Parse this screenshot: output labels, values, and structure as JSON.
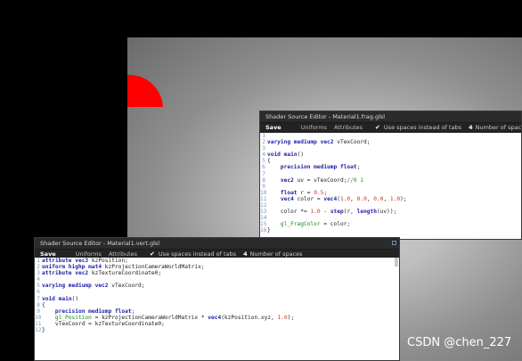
{
  "frag_editor": {
    "title": "Shader Source Editor - Material1.frag.glsl",
    "save_label": "Save",
    "tab_uniforms": "Uniforms",
    "tab_attributes": "Attributes",
    "checkbox_label": "Use spaces instead of tabs",
    "spaces_value": "4",
    "spaces_label": "Number of spaces",
    "lines": [
      {
        "n": "1",
        "segs": []
      },
      {
        "n": "2",
        "segs": [
          [
            "kw",
            "varying mediump vec2"
          ],
          [
            "txt",
            " vTexCoord;"
          ]
        ]
      },
      {
        "n": "3",
        "segs": []
      },
      {
        "n": "4",
        "segs": [
          [
            "kw",
            "void"
          ],
          [
            "txt",
            " "
          ],
          [
            "kw",
            "main"
          ],
          [
            "txt",
            "()"
          ]
        ]
      },
      {
        "n": "5",
        "segs": [
          [
            "txt",
            "{"
          ]
        ]
      },
      {
        "n": "6",
        "segs": [
          [
            "txt",
            "    "
          ],
          [
            "kw",
            "precision mediump float"
          ],
          [
            "txt",
            ";"
          ]
        ]
      },
      {
        "n": "7",
        "segs": []
      },
      {
        "n": "8",
        "segs": [
          [
            "txt",
            "    "
          ],
          [
            "kw",
            "vec2"
          ],
          [
            "txt",
            " uv = vTexCoord;"
          ],
          [
            "com",
            "//0 1"
          ]
        ]
      },
      {
        "n": "9",
        "segs": []
      },
      {
        "n": "10",
        "segs": [
          [
            "txt",
            "    "
          ],
          [
            "kw",
            "float"
          ],
          [
            "txt",
            " r = "
          ],
          [
            "num-lit",
            "0.5"
          ],
          [
            "txt",
            ";"
          ]
        ]
      },
      {
        "n": "11",
        "segs": [
          [
            "txt",
            "    "
          ],
          [
            "kw",
            "vec4"
          ],
          [
            "txt",
            " color = "
          ],
          [
            "kw",
            "vec4"
          ],
          [
            "txt",
            "("
          ],
          [
            "num-lit",
            "1.0"
          ],
          [
            "txt",
            ", "
          ],
          [
            "num-lit",
            "0.0"
          ],
          [
            "txt",
            ", "
          ],
          [
            "num-lit",
            "0.0"
          ],
          [
            "txt",
            ", "
          ],
          [
            "num-lit",
            "1.0"
          ],
          [
            "txt",
            ");"
          ]
        ]
      },
      {
        "n": "12",
        "segs": []
      },
      {
        "n": "13",
        "segs": [
          [
            "txt",
            "    color *= "
          ],
          [
            "num-lit",
            "1.0"
          ],
          [
            "txt",
            " - "
          ],
          [
            "kw",
            "step"
          ],
          [
            "txt",
            "(r, "
          ],
          [
            "kw",
            "length"
          ],
          [
            "txt",
            "(uv));"
          ]
        ]
      },
      {
        "n": "14",
        "segs": []
      },
      {
        "n": "15",
        "segs": [
          [
            "txt",
            "    "
          ],
          [
            "fn",
            "gl_FragColor"
          ],
          [
            "txt",
            " = color;"
          ]
        ]
      },
      {
        "n": "16",
        "segs": [
          [
            "txt",
            "}"
          ]
        ]
      }
    ]
  },
  "vert_editor": {
    "title": "Shader Source Editor - Material1.vert.glsl",
    "save_label": "Save",
    "tab_uniforms": "Uniforms",
    "tab_attributes": "Attributes",
    "checkbox_label": "Use spaces instead of tabs",
    "spaces_value": "4",
    "spaces_label": "Number of spaces",
    "lines": [
      {
        "n": "1",
        "segs": [
          [
            "kw",
            "attribute vec3"
          ],
          [
            "txt",
            " kzPosition;"
          ]
        ]
      },
      {
        "n": "2",
        "segs": [
          [
            "kw",
            "uniform highp mat4"
          ],
          [
            "txt",
            " kzProjectionCameraWorldMatrix;"
          ]
        ]
      },
      {
        "n": "3",
        "segs": [
          [
            "kw",
            "attribute vec2"
          ],
          [
            "txt",
            " kzTextureCoordinate0;"
          ]
        ]
      },
      {
        "n": "4",
        "segs": []
      },
      {
        "n": "5",
        "segs": [
          [
            "kw",
            "varying mediump vec2"
          ],
          [
            "txt",
            " vTexCoord;"
          ]
        ]
      },
      {
        "n": "6",
        "segs": []
      },
      {
        "n": "7",
        "segs": [
          [
            "kw",
            "void"
          ],
          [
            "txt",
            " "
          ],
          [
            "kw",
            "main"
          ],
          [
            "txt",
            "()"
          ]
        ]
      },
      {
        "n": "8",
        "segs": [
          [
            "txt",
            "{"
          ]
        ]
      },
      {
        "n": "9",
        "segs": [
          [
            "txt",
            "    "
          ],
          [
            "kw",
            "precision mediump float"
          ],
          [
            "txt",
            ";"
          ]
        ]
      },
      {
        "n": "10",
        "segs": [
          [
            "txt",
            "    "
          ],
          [
            "fn",
            "gl_Position"
          ],
          [
            "txt",
            " = kzProjectionCameraWorldMatrix * "
          ],
          [
            "kw",
            "vec4"
          ],
          [
            "txt",
            "(kzPosition.xyz, "
          ],
          [
            "num-lit",
            "1.0"
          ],
          [
            "txt",
            ");"
          ]
        ]
      },
      {
        "n": "11",
        "segs": [
          [
            "txt",
            "    vTexCoord = kzTextureCoordinate0;"
          ]
        ]
      },
      {
        "n": "12",
        "segs": [
          [
            "txt",
            "}"
          ]
        ]
      }
    ]
  },
  "watermark": "CSDN @chen_227",
  "colors": {
    "background": "#000000",
    "viewport_center": "#d6d6d6",
    "shape": "#ff0000",
    "editor_dark": "#1e1e1e",
    "keyword": "#2020a8",
    "number": "#c0392b",
    "comment": "#2e8b2e"
  },
  "icons": {
    "checkbox": "checkmark-icon",
    "close": "window-close-icon"
  }
}
